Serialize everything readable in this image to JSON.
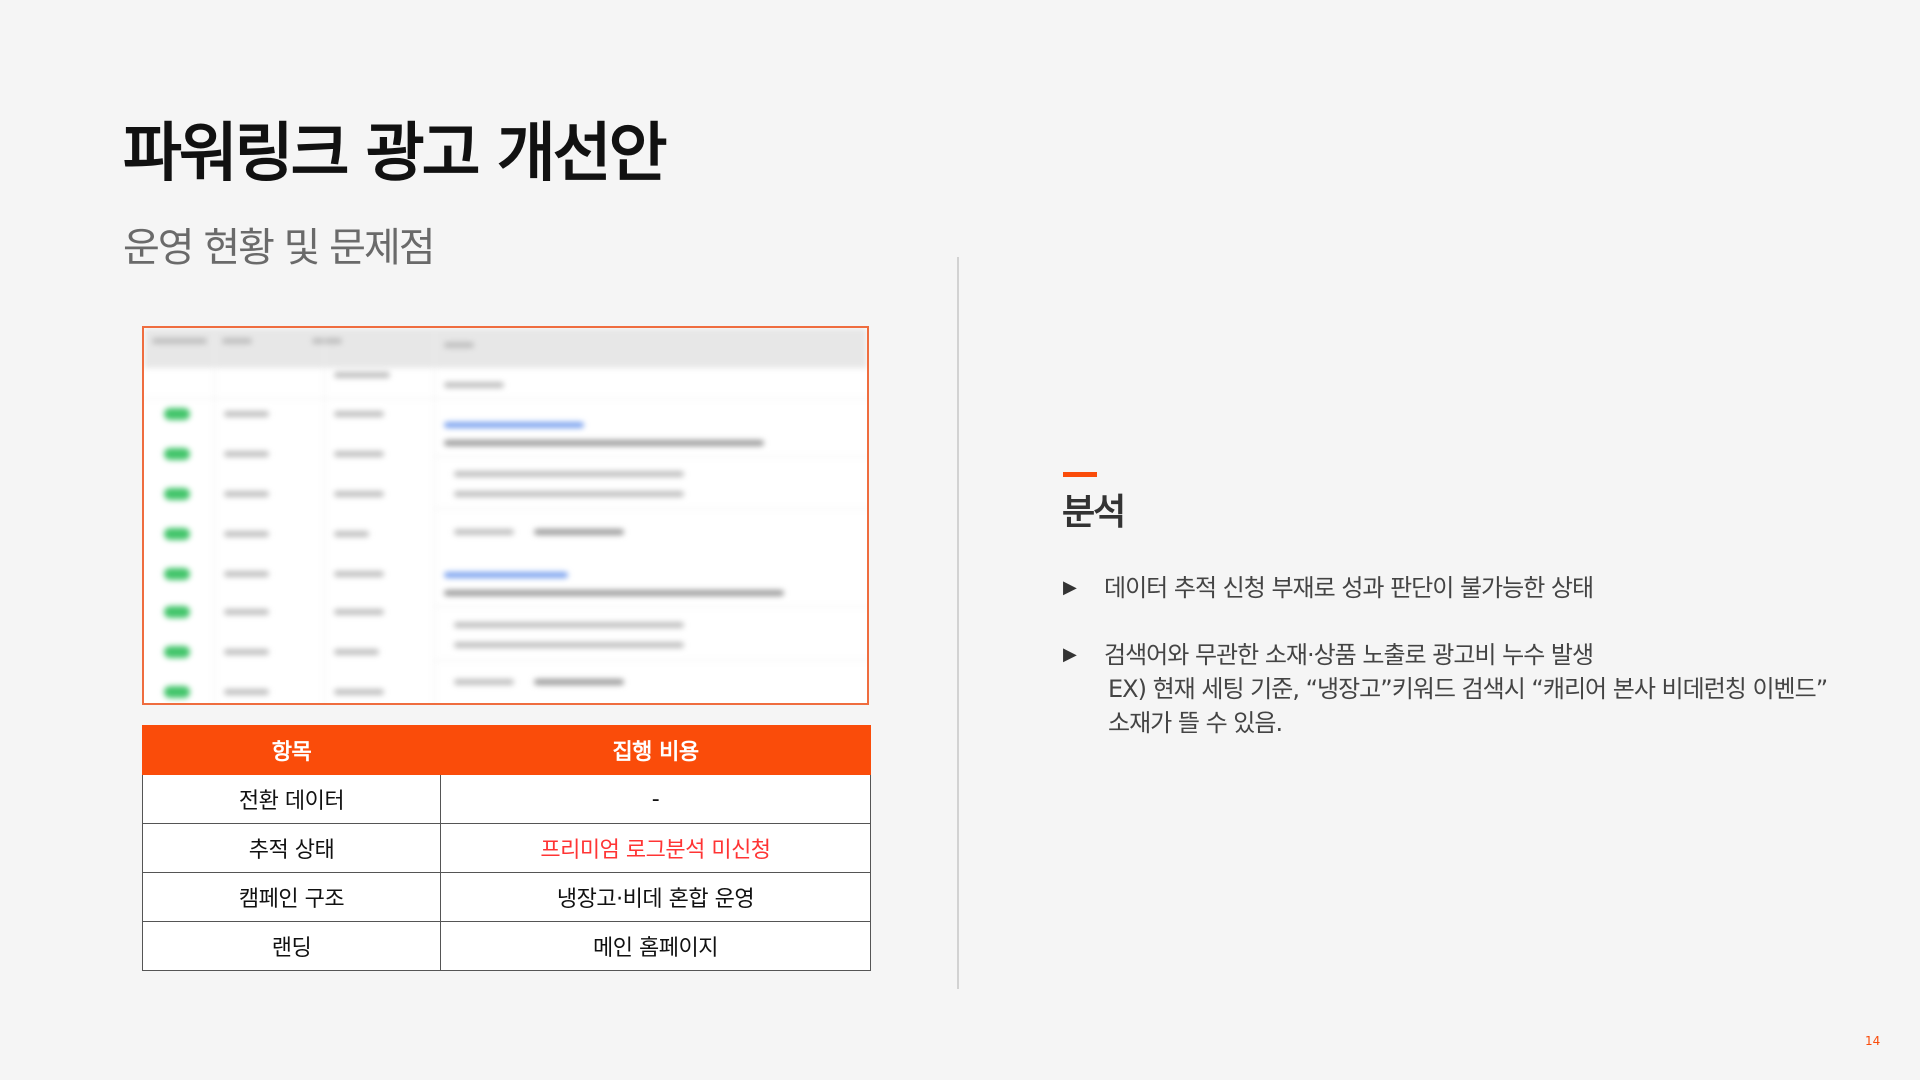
{
  "header": {
    "title": "파워링크 광고 개선안",
    "subtitle": "운영 현황 및 문제점"
  },
  "table": {
    "headers": [
      "항목",
      "집행 비용"
    ],
    "rows": [
      [
        "전환 데이터",
        "-"
      ],
      [
        "추적 상태",
        "프리미엄 로그분석 미신청"
      ],
      [
        "캠페인 구조",
        "냉장고·비데 혼합 운영"
      ],
      [
        "랜딩",
        "메인 홈페이지"
      ]
    ]
  },
  "analysis": {
    "title": "분석",
    "bullets": [
      {
        "text": "데이터 추적 신청 부재로 성과 판단이 불가능한 상태",
        "sub": []
      },
      {
        "text": "검색어와 무관한 소재·상품 노출로 광고비 누수 발생",
        "sub": [
          "EX) 현재 세팅 기준, “냉장고”키워드 검색시 “캐리어 본사 비데런칭 이벤드”",
          "소재가 뜰 수 있음."
        ]
      }
    ]
  },
  "page_number": "14",
  "colors": {
    "accent": "#fa4c0a",
    "highlight_text": "#ff3434"
  }
}
